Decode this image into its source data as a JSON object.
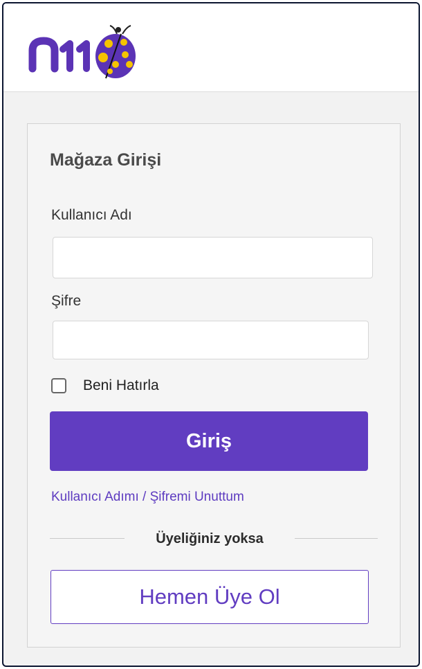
{
  "brand": {
    "logo_text": "n11",
    "color": "#613dc1",
    "accent": "#f5c400"
  },
  "login": {
    "title": "Mağaza Girişi",
    "username_label": "Kullanıcı Adı",
    "username_value": "",
    "password_label": "Şifre",
    "password_value": "",
    "remember_label": "Beni Hatırla",
    "remember_checked": false,
    "submit_label": "Giriş",
    "forgot_link": "Kullanıcı Adımı / Şifremi Unuttum"
  },
  "signup": {
    "divider_text": "Üyeliğiniz yoksa",
    "button_label": "Hemen Üye Ol"
  }
}
